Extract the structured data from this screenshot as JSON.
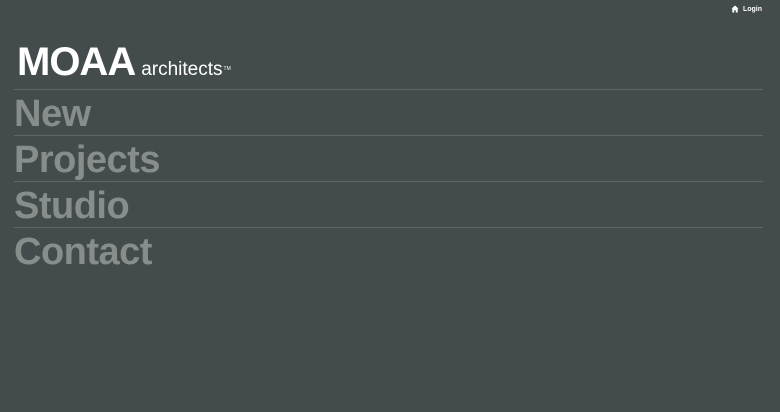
{
  "header": {
    "login_label": "Login",
    "login_icon": "home-icon"
  },
  "logo": {
    "brand": "MOAA",
    "sub": "architects",
    "tm": "TM"
  },
  "nav": {
    "items": [
      {
        "label": "New"
      },
      {
        "label": "Projects"
      },
      {
        "label": "Studio"
      },
      {
        "label": "Contact"
      }
    ]
  },
  "colors": {
    "background": "#434b4c",
    "nav_text": "#878d8b",
    "divider": "#5d6567",
    "logo_text": "#ffffff"
  }
}
